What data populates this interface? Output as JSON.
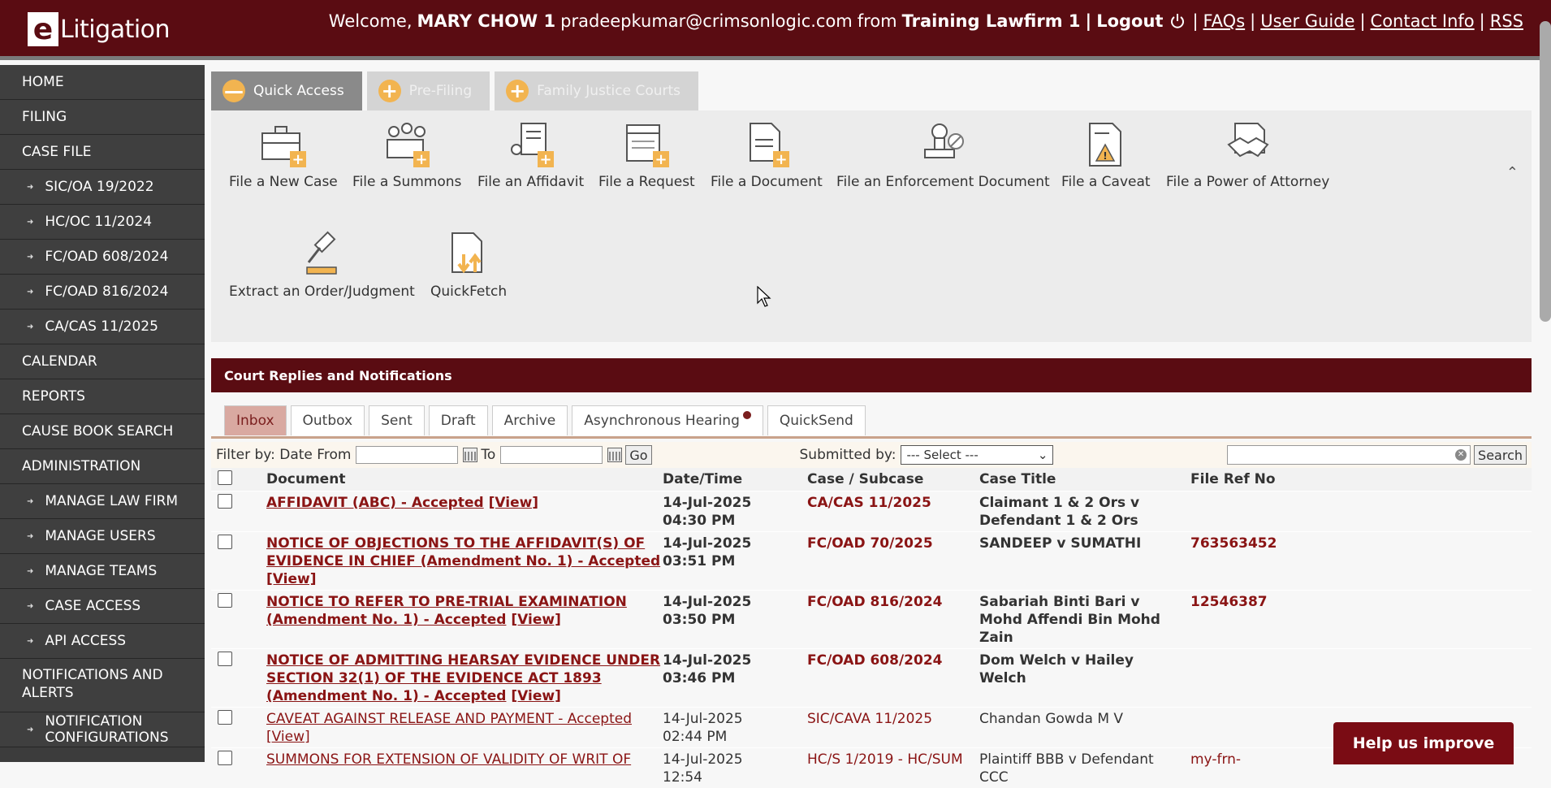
{
  "header": {
    "logo_letter": "e",
    "logo_text": "Litigation",
    "welcome": "Welcome,",
    "user": "MARY CHOW 1",
    "email": "pradeepkumar@crimsonlogic.com",
    "from": "from",
    "firm": "Training Lawfirm 1",
    "sep": "|",
    "logout": "Logout",
    "faqs": "FAQs",
    "user_guide": "User Guide",
    "contact": "Contact Info",
    "rss": "RSS"
  },
  "sidebar": {
    "items": [
      {
        "label": "HOME"
      },
      {
        "label": "FILING"
      },
      {
        "label": "CASE FILE"
      },
      {
        "label": "SIC/OA 19/2022"
      },
      {
        "label": "HC/OC 11/2024"
      },
      {
        "label": "FC/OAD 608/2024"
      },
      {
        "label": "FC/OAD 816/2024"
      },
      {
        "label": "CA/CAS 11/2025"
      },
      {
        "label": "CALENDAR"
      },
      {
        "label": "REPORTS"
      },
      {
        "label": "CAUSE BOOK SEARCH"
      },
      {
        "label": "ADMINISTRATION"
      },
      {
        "label": "MANAGE LAW FIRM"
      },
      {
        "label": "MANAGE USERS"
      },
      {
        "label": "MANAGE TEAMS"
      },
      {
        "label": "CASE ACCESS"
      },
      {
        "label": "API ACCESS"
      },
      {
        "label": "NOTIFICATIONS AND ALERTS"
      },
      {
        "label": "NOTIFICATION CONFIGURATIONS"
      }
    ]
  },
  "top_tabs": [
    {
      "label": "Quick Access",
      "symbol": "—"
    },
    {
      "label": "Pre-Filing",
      "symbol": "+"
    },
    {
      "label": "Family Justice Courts",
      "symbol": "+"
    }
  ],
  "quick_access": {
    "items": [
      {
        "label": "File a New Case"
      },
      {
        "label": "File a Summons"
      },
      {
        "label": "File an Affidavit"
      },
      {
        "label": "File a Request"
      },
      {
        "label": "File a Document"
      },
      {
        "label": "File an Enforcement Document"
      },
      {
        "label": "File a Caveat"
      },
      {
        "label": "File a Power of Attorney"
      },
      {
        "label": "Extract an Order/Judgment"
      },
      {
        "label": "QuickFetch"
      }
    ],
    "collapse_symbol": "⌃"
  },
  "notifications": {
    "title": "Court Replies and Notifications",
    "tabs": [
      "Inbox",
      "Outbox",
      "Sent",
      "Draft",
      "Archive",
      "Asynchronous Hearing",
      "QuickSend"
    ],
    "filter": {
      "label": "Filter by: Date From",
      "to": "To",
      "go": "Go",
      "submitted_by": "Submitted by:",
      "select_value": "--- Select ---",
      "search": "Search"
    },
    "columns": [
      "Document",
      "Date/Time",
      "Case / Subcase",
      "Case Title",
      "File Ref No"
    ],
    "rows": [
      {
        "doc": "AFFIDAVIT (ABC) - Accepted",
        "view": "[View]",
        "date": "14-Jul-2025 04:30 PM",
        "case": "CA/CAS 11/2025",
        "title": "Claimant 1 & 2 Ors v Defendant 1 & 2 Ors",
        "ref": ""
      },
      {
        "doc": "NOTICE OF OBJECTIONS TO THE AFFIDAVIT(S) OF EVIDENCE IN CHIEF (Amendment No. 1) - Accepted",
        "view": "[View]",
        "date": "14-Jul-2025 03:51 PM",
        "case": "FC/OAD 70/2025",
        "title": "SANDEEP v SUMATHI",
        "ref": "763563452"
      },
      {
        "doc": "NOTICE TO REFER TO PRE-TRIAL EXAMINATION (Amendment No. 1) - Accepted",
        "view": "[View]",
        "date": "14-Jul-2025 03:50 PM",
        "case": "FC/OAD 816/2024",
        "title": "Sabariah Binti Bari v Mohd Affendi Bin Mohd Zain",
        "ref": "12546387"
      },
      {
        "doc": "NOTICE OF ADMITTING HEARSAY EVIDENCE UNDER SECTION 32(1) OF THE EVIDENCE ACT 1893 (Amendment No. 1) - Accepted",
        "view": "[View]",
        "date": "14-Jul-2025 03:46 PM",
        "case": "FC/OAD 608/2024",
        "title": "Dom Welch v Hailey Welch",
        "ref": ""
      },
      {
        "doc": "CAVEAT AGAINST RELEASE AND PAYMENT - Accepted",
        "view": "[View]",
        "date": "14-Jul-2025 02:44 PM",
        "case": "SIC/CAVA 11/2025",
        "title": "Chandan Gowda M V",
        "ref": ""
      },
      {
        "doc": "SUMMONS FOR EXTENSION OF VALIDITY OF WRIT OF",
        "view": "",
        "date": "14-Jul-2025 12:54",
        "case": "HC/S 1/2019 - HC/SUM",
        "title": "Plaintiff BBB v Defendant CCC",
        "ref": "my-frn-"
      }
    ]
  },
  "help_button": "Help us improve",
  "colors": {
    "brand": "#5a0c12",
    "accent": "#f2b450",
    "link": "#8a1414"
  }
}
